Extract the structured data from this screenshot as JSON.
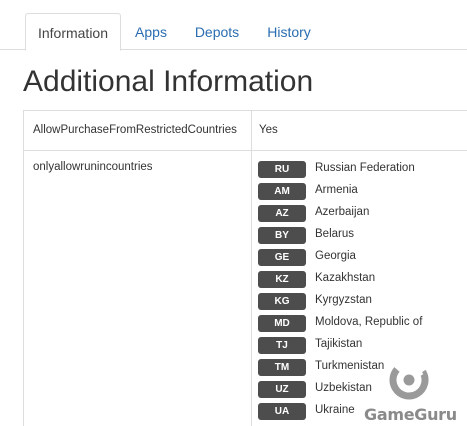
{
  "tabs": [
    {
      "label": "Information",
      "active": true
    },
    {
      "label": "Apps",
      "active": false
    },
    {
      "label": "Depots",
      "active": false
    },
    {
      "label": "History",
      "active": false
    }
  ],
  "page_title": "Additional Information",
  "rows": [
    {
      "key": "AllowPurchaseFromRestrictedCountries",
      "value": "Yes"
    },
    {
      "key": "onlyallowrunincountries"
    }
  ],
  "countries": [
    {
      "code": "RU",
      "name": "Russian Federation"
    },
    {
      "code": "AM",
      "name": "Armenia"
    },
    {
      "code": "AZ",
      "name": "Azerbaijan"
    },
    {
      "code": "BY",
      "name": "Belarus"
    },
    {
      "code": "GE",
      "name": "Georgia"
    },
    {
      "code": "KZ",
      "name": "Kazakhstan"
    },
    {
      "code": "KG",
      "name": "Kyrgyzstan"
    },
    {
      "code": "MD",
      "name": "Moldova, Republic of"
    },
    {
      "code": "TJ",
      "name": "Tajikistan"
    },
    {
      "code": "TM",
      "name": "Turkmenistan"
    },
    {
      "code": "UZ",
      "name": "Uzbekistan"
    },
    {
      "code": "UA",
      "name": "Ukraine"
    }
  ],
  "watermark": {
    "text": "GameGuru",
    "icon": "gameguru-logo-icon"
  },
  "colors": {
    "link": "#2a6db0",
    "badge_bg": "#4d4d4d",
    "border": "#dddddd",
    "text": "#333333",
    "watermark": "#8a8a8a"
  }
}
